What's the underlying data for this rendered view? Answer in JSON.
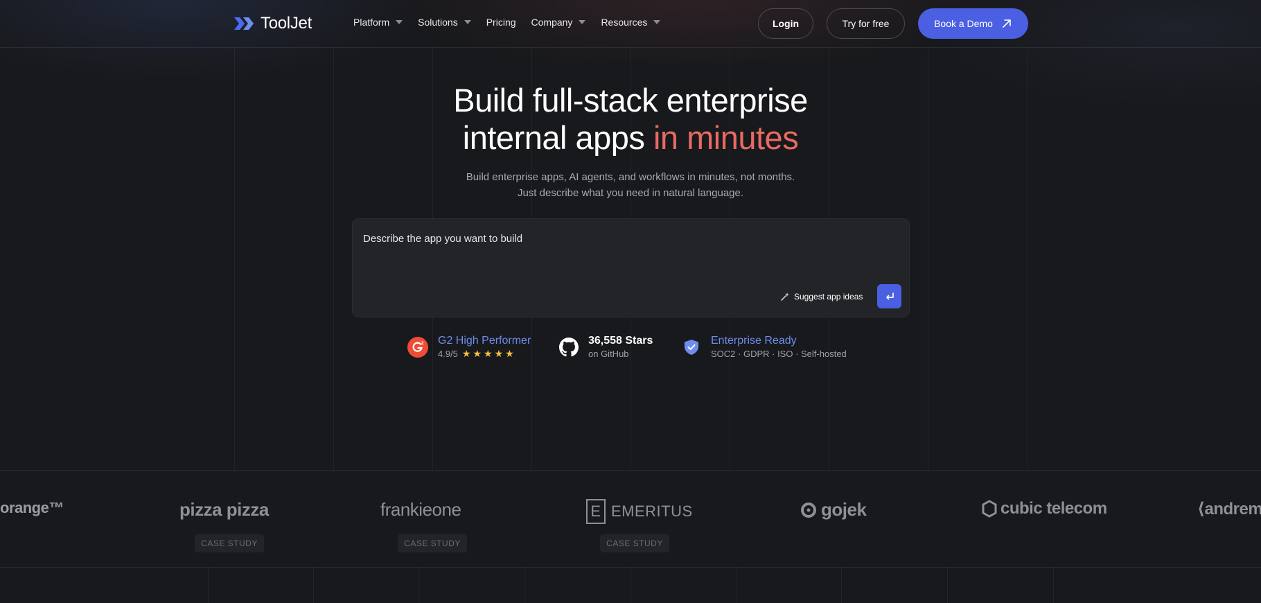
{
  "nav": {
    "logo_text": "ToolJet",
    "menu": [
      {
        "label": "Platform",
        "has_dropdown": true
      },
      {
        "label": "Solutions",
        "has_dropdown": true
      },
      {
        "label": "Pricing",
        "has_dropdown": false
      },
      {
        "label": "Company",
        "has_dropdown": true
      },
      {
        "label": "Resources",
        "has_dropdown": true
      }
    ],
    "login_label": "Login",
    "try_label": "Try for free",
    "demo_label": "Book a Demo"
  },
  "hero": {
    "title_line1": "Build full-stack enterprise",
    "title_line2_plain": "internal apps ",
    "title_line2_accent": "in minutes",
    "subtitle": "Build enterprise apps, AI agents, and workflows in minutes, not months. Just describe what you need in natural language."
  },
  "prompt": {
    "placeholder": "Describe the app you want to build",
    "suggest_label": "Suggest app ideas",
    "send_icon": "enter-icon"
  },
  "badges": {
    "g2": {
      "title": "G2 High Performer",
      "rating": "4.9/5",
      "stars": "★★★★★"
    },
    "github": {
      "title": "36,558 Stars",
      "sub": "on GitHub"
    },
    "enterprise": {
      "title": "Enterprise Ready",
      "sub": "SOC2 · GDPR · ISO · Self-hosted"
    }
  },
  "logos": {
    "items": [
      "orange™",
      "pizza pizza",
      "frankieone",
      "EMERITUS",
      "gojek",
      "cubic telecom",
      "⟨andrem"
    ],
    "case_study_label": "CASE STUDY"
  },
  "colors": {
    "background": "#18191c",
    "accent_red": "#e86a63",
    "brand_blue": "#4b5fe3",
    "link_blue": "#6f8cf0",
    "star_yellow": "#f5c242"
  }
}
